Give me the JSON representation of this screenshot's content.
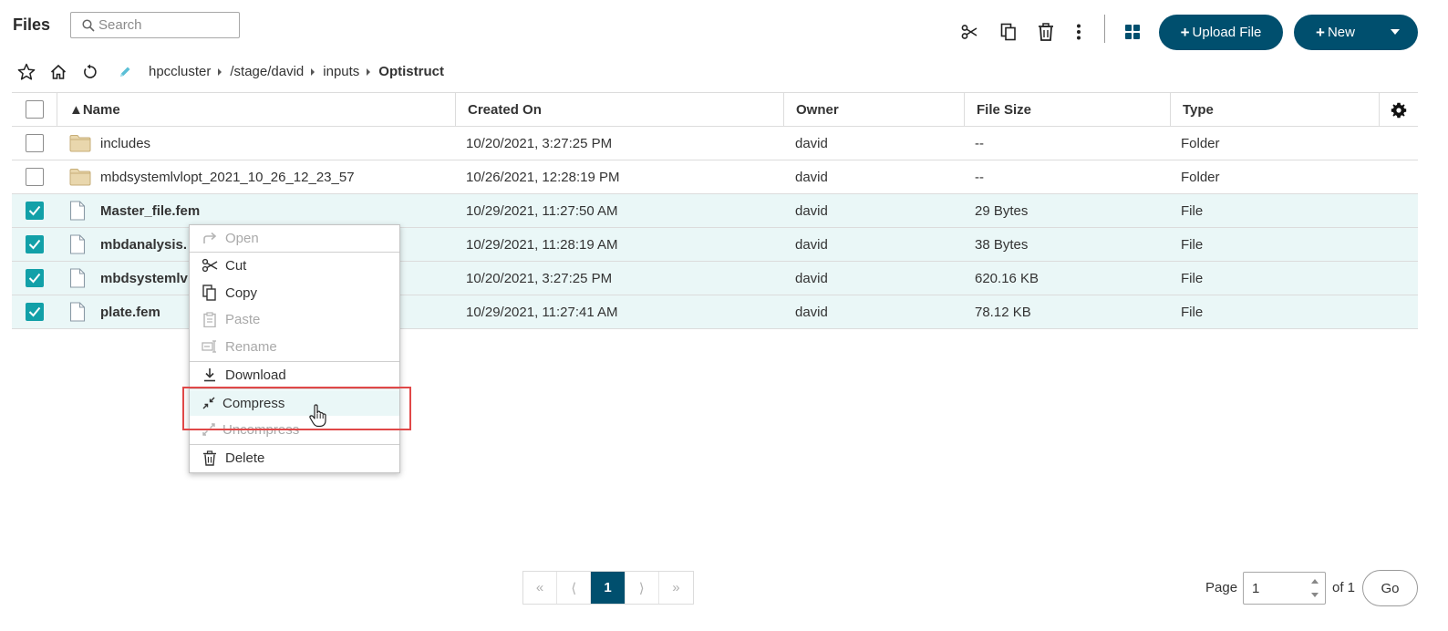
{
  "header": {
    "title": "Files",
    "search_placeholder": "Search",
    "upload_label": "Upload File",
    "new_label": "New",
    "accent_color": "#004f6e"
  },
  "breadcrumb": {
    "crumbs": [
      "hpccluster",
      "/stage/david",
      "inputs"
    ],
    "current": "Optistruct"
  },
  "table": {
    "columns": [
      "▲Name",
      "Created On",
      "Owner",
      "File Size",
      "Type"
    ],
    "rows": [
      {
        "name": "includes",
        "created": "10/20/2021, 3:27:25 PM",
        "owner": "david",
        "size": "--",
        "type": "Folder",
        "selected": false,
        "kind": "folder"
      },
      {
        "name": "mbdsystemlvlopt_2021_10_26_12_23_57",
        "created": "10/26/2021, 12:28:19 PM",
        "owner": "david",
        "size": "--",
        "type": "Folder",
        "selected": false,
        "kind": "folder"
      },
      {
        "name": "Master_file.fem",
        "created": "10/29/2021, 11:27:50 AM",
        "owner": "david",
        "size": "29 Bytes",
        "type": "File",
        "selected": true,
        "kind": "file"
      },
      {
        "name": "mbdanalysis.",
        "created": "10/29/2021, 11:28:19 AM",
        "owner": "david",
        "size": "38 Bytes",
        "type": "File",
        "selected": true,
        "kind": "file"
      },
      {
        "name": "mbdsystemlv",
        "created": "10/20/2021, 3:27:25 PM",
        "owner": "david",
        "size": "620.16 KB",
        "type": "File",
        "selected": true,
        "kind": "file"
      },
      {
        "name": "plate.fem",
        "created": "10/29/2021, 11:27:41 AM",
        "owner": "david",
        "size": "78.12 KB",
        "type": "File",
        "selected": true,
        "kind": "file"
      }
    ]
  },
  "context_menu": {
    "items": [
      {
        "label": "Open",
        "enabled": false,
        "icon": "open-icon"
      },
      {
        "label": "Cut",
        "enabled": true,
        "icon": "scissors-icon"
      },
      {
        "label": "Copy",
        "enabled": true,
        "icon": "copy-icon"
      },
      {
        "label": "Paste",
        "enabled": false,
        "icon": "paste-icon"
      },
      {
        "label": "Rename",
        "enabled": false,
        "icon": "rename-icon"
      },
      {
        "label": "Download",
        "enabled": true,
        "icon": "download-icon"
      },
      {
        "label": "Compress",
        "enabled": true,
        "icon": "compress-icon",
        "hovered": true
      },
      {
        "label": "Uncompress",
        "enabled": false,
        "icon": "uncompress-icon"
      },
      {
        "label": "Delete",
        "enabled": true,
        "icon": "trash-icon"
      }
    ]
  },
  "pagination": {
    "first": "«",
    "prev": "⟨",
    "current_page": "1",
    "next": "⟩",
    "last": "»",
    "page_label": "Page",
    "page_value": "1",
    "of_label": "of 1",
    "go_label": "Go"
  }
}
